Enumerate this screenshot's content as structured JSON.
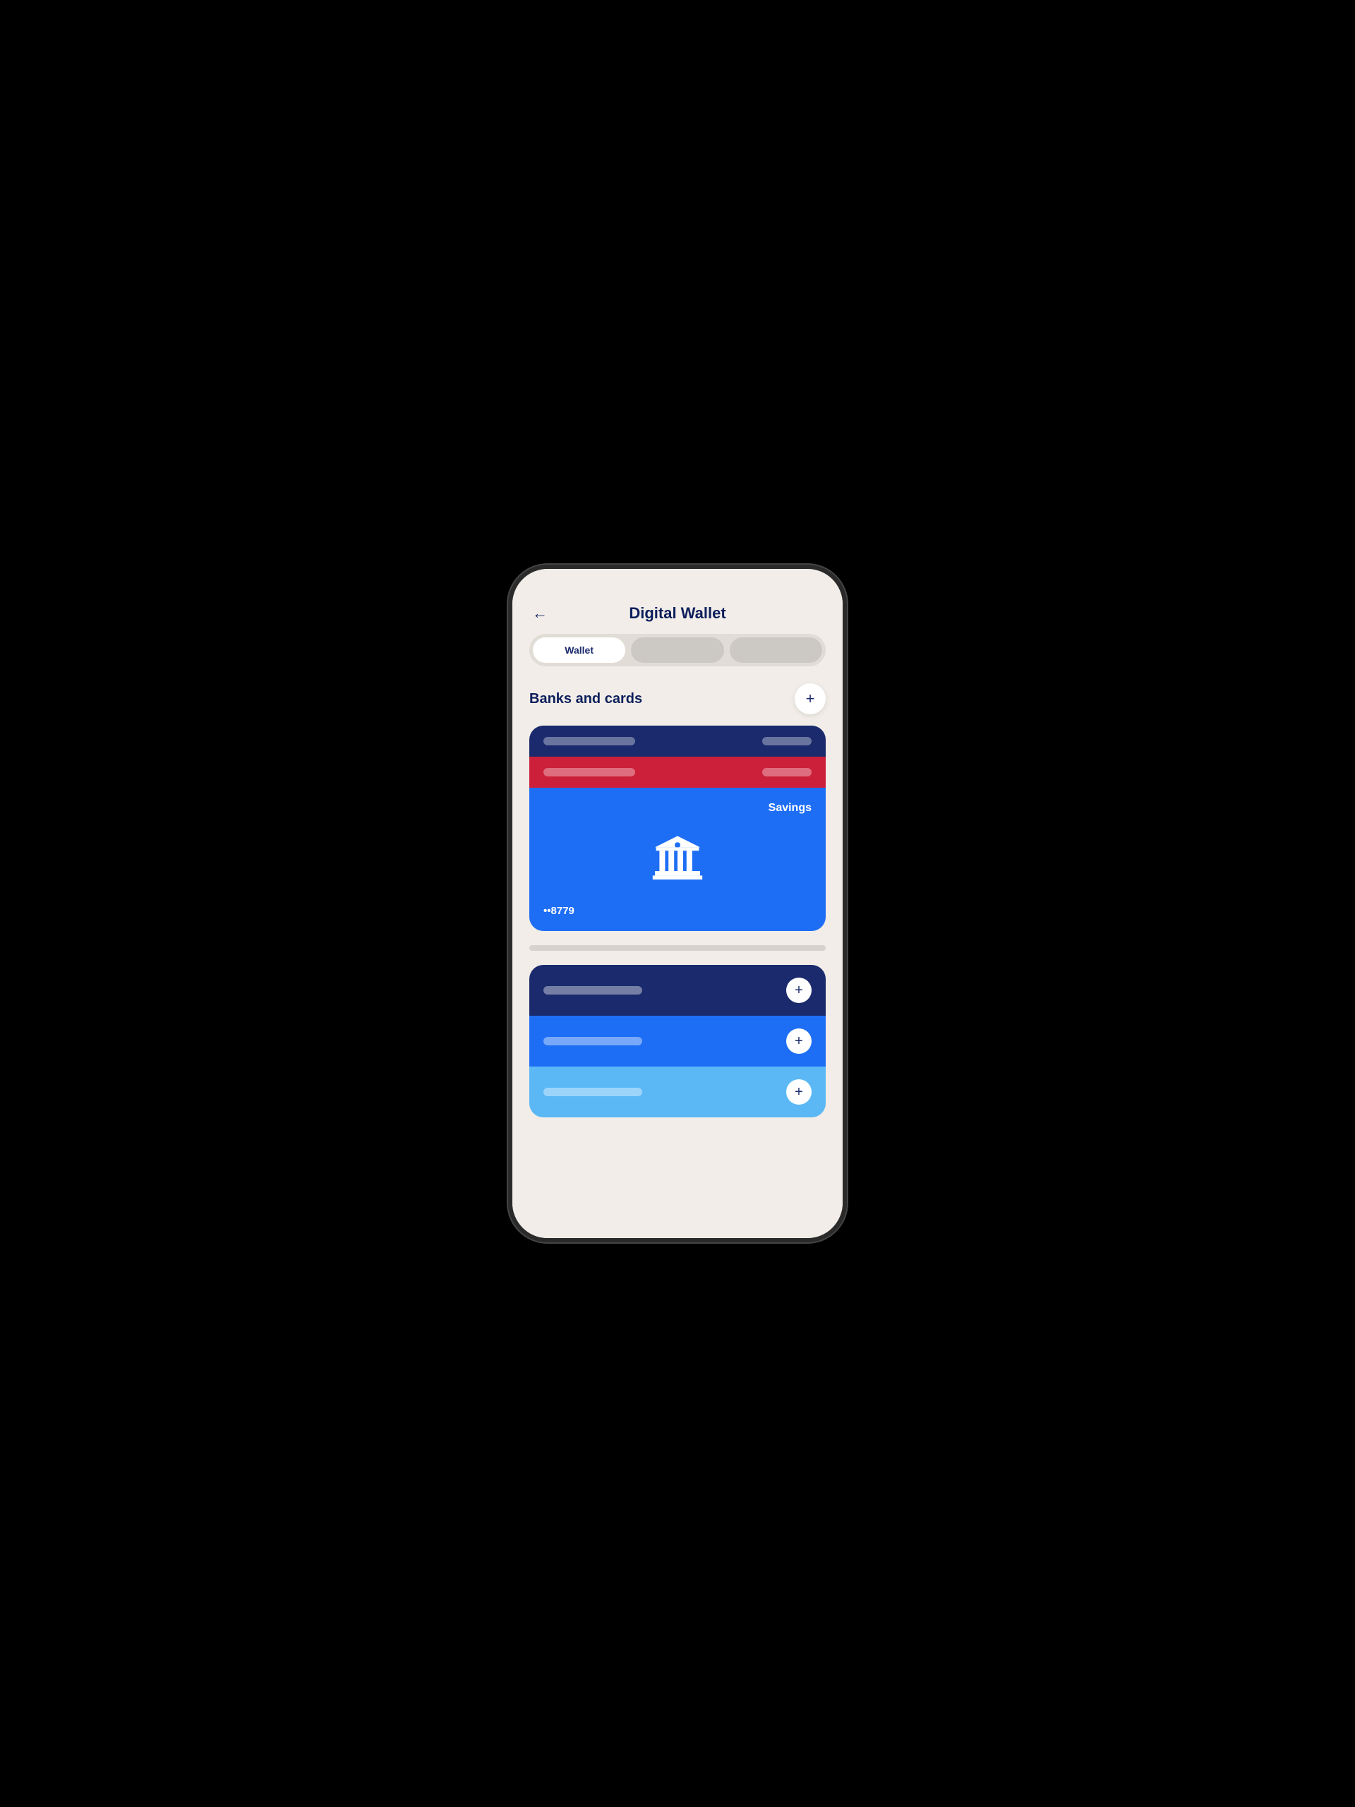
{
  "header": {
    "title": "Digital Wallet",
    "back_label": "←"
  },
  "tabs": [
    {
      "label": "Wallet",
      "active": true
    },
    {
      "label": "",
      "active": false
    },
    {
      "label": "",
      "active": false
    }
  ],
  "banks_section": {
    "title": "Banks and cards",
    "add_label": "+",
    "card_label": "Savings",
    "card_number": "••8779",
    "card_rows": [
      {
        "type": "dark"
      },
      {
        "type": "red"
      },
      {
        "type": "blue"
      }
    ]
  },
  "add_section": {
    "rows": [
      {
        "bg": "dark",
        "add": "+"
      },
      {
        "bg": "blue",
        "add": "+"
      },
      {
        "bg": "light",
        "add": "+"
      }
    ]
  }
}
